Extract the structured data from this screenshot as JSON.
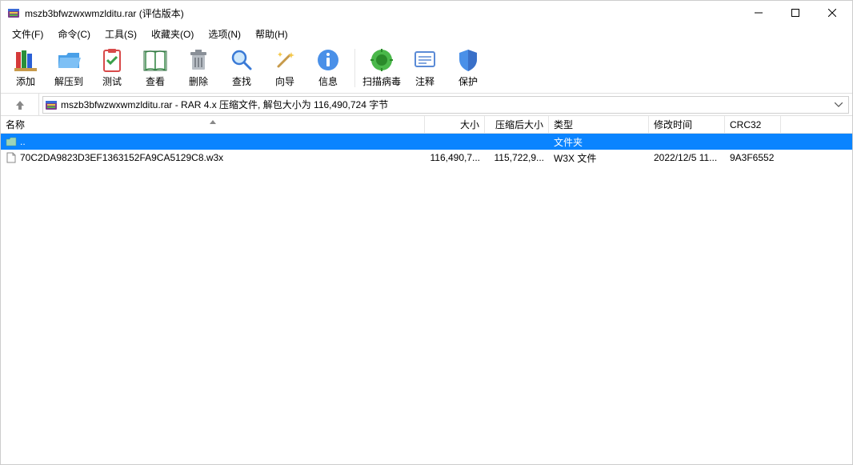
{
  "titlebar": {
    "title": "mszb3bfwzwxwmzlditu.rar (评估版本)"
  },
  "menu": {
    "file": "文件(F)",
    "cmd": "命令(C)",
    "tools": "工具(S)",
    "fav": "收藏夹(O)",
    "opt": "选项(N)",
    "help": "帮助(H)"
  },
  "toolbar": {
    "add": "添加",
    "extract": "解压到",
    "test": "测试",
    "view": "查看",
    "delete": "删除",
    "find": "查找",
    "wizard": "向导",
    "info": "信息",
    "scan": "扫描病毒",
    "comment": "注释",
    "protect": "保护"
  },
  "path": {
    "text": "mszb3bfwzwxwmzlditu.rar - RAR 4.x 压缩文件, 解包大小为 116,490,724 字节"
  },
  "headers": {
    "name": "名称",
    "size": "大小",
    "packed": "压缩后大小",
    "type": "类型",
    "mtime": "修改时间",
    "crc": "CRC32"
  },
  "rows": {
    "r0": {
      "name": "..",
      "type": "文件夹"
    },
    "r1": {
      "name": "70C2DA9823D3EF1363152FA9CA5129C8.w3x",
      "size": "116,490,7...",
      "packed": "115,722,9...",
      "type": "W3X 文件",
      "mtime": "2022/12/5 11...",
      "crc": "9A3F6552"
    }
  }
}
